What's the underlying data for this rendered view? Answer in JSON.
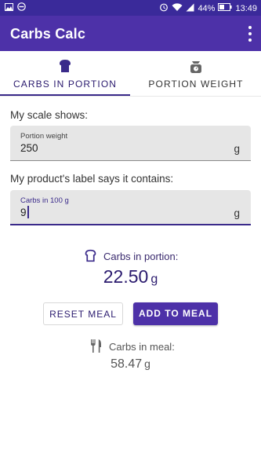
{
  "status_bar": {
    "battery": "44%",
    "time": "13:49",
    "left_icons": [
      "image-icon",
      "do-not-disturb-icon"
    ],
    "right_icons": [
      "alarm-icon",
      "wifi-icon",
      "signal-icon",
      "battery-icon"
    ]
  },
  "app_bar": {
    "title": "Carbs Calc",
    "menu_icon": "overflow-menu-icon"
  },
  "tabs": [
    {
      "label": "CARBS IN PORTION",
      "icon": "bread-icon",
      "active": true
    },
    {
      "label": "PORTION WEIGHT",
      "icon": "scale-icon",
      "active": false
    }
  ],
  "form": {
    "scale_prompt": "My scale shows:",
    "portion_weight": {
      "label": "Portion weight",
      "value": "250",
      "unit": "g"
    },
    "label_prompt": "My product's label says it contains:",
    "carbs_per_100g": {
      "label": "Carbs in 100 g",
      "value": "9",
      "unit": "g"
    }
  },
  "result": {
    "label": "Carbs in portion:",
    "value": "22.50",
    "unit": "g"
  },
  "buttons": {
    "reset": "RESET MEAL",
    "add": "ADD TO MEAL"
  },
  "meal": {
    "label": "Carbs in meal:",
    "value": "58.47",
    "unit": "g"
  },
  "colors": {
    "primary": "#4d31a8",
    "status_bar": "#3a2a9a",
    "accent_text": "#2a1a6e"
  }
}
